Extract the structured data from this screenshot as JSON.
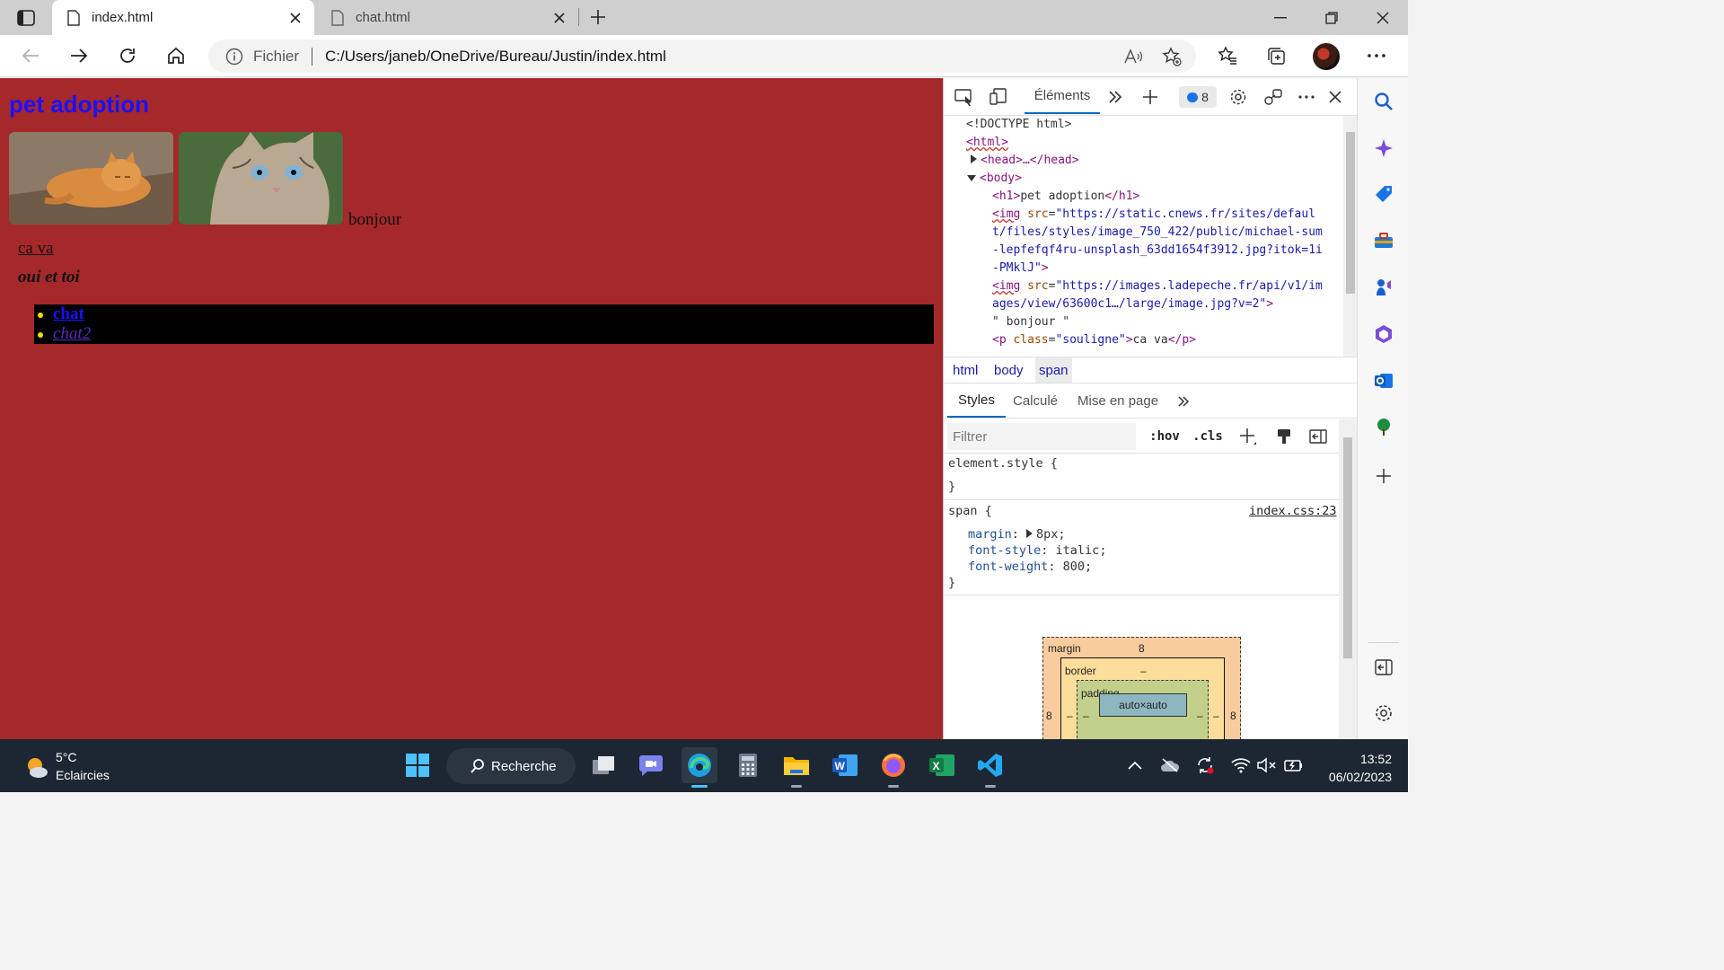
{
  "browser": {
    "tabs": [
      {
        "title": "index.html",
        "active": true
      },
      {
        "title": "chat.html",
        "active": false
      }
    ],
    "address": {
      "scheme_label": "Fichier",
      "url": "C:/Users/janeb/OneDrive/Bureau/Justin/index.html"
    }
  },
  "page": {
    "heading": "pet adoption",
    "text_bonjour": "bonjour",
    "text_cava": "ca va",
    "text_ouietoi": "oui et toi",
    "links": [
      "chat",
      "chat2"
    ],
    "background_color": "#a5282a"
  },
  "devtools": {
    "active_tab": "Éléments",
    "issues_count": "8",
    "dom": {
      "doctype": "<!DOCTYPE html>",
      "html_open": "<html>",
      "head_collapsed": "<head>…</head>",
      "body_open": "<body>",
      "h1_line": "pet adoption",
      "img1_src_1": "\"https://static.cnews.fr/sites/defaul",
      "img1_src_2": "t/files/styles/image_750_422/public/michael-sum",
      "img1_src_3": "-lepfefqf4ru-unsplash_63dd1654f3912.jpg?itok=1i",
      "img1_src_4": "-PMklJ\"",
      "img2_src_1": "\"https://images.ladepeche.fr/api/v1/im",
      "img2_src_2": "ages/view/63600c1…/large/image.jpg?v=2\"",
      "text_node": "\" bonjour \"",
      "p_class": "\"souligne\"",
      "p_text": "ca va"
    },
    "breadcrumbs": [
      "html",
      "body",
      "span"
    ],
    "style_tabs": [
      "Styles",
      "Calculé",
      "Mise en page"
    ],
    "filter_placeholder": "Filtrer",
    "tools": {
      "hov": ":hov",
      "cls": ".cls"
    },
    "rules": {
      "element_style": "element.style {",
      "close": "}",
      "span_selector": "span {",
      "source": "index.css:23",
      "margin_prop": "margin",
      "margin_val": "8px;",
      "font_style_prop": "font-style",
      "font_style_val": "italic;",
      "font_weight_prop": "font-weight",
      "font_weight_val": "800;"
    },
    "box_model": {
      "margin_label": "margin",
      "margin_top": "8",
      "margin_left": "8",
      "margin_right": "8",
      "border_label": "border",
      "border_top": "–",
      "border_left": "–",
      "border_right": "–",
      "padding_label": "padding",
      "padding_top": "–",
      "padding_left": "–",
      "padding_right": "–",
      "content": "auto×auto"
    }
  },
  "taskbar": {
    "weather_temp": "5°C",
    "weather_desc": "Eclaircies",
    "search_label": "Recherche",
    "time": "13:52",
    "date": "06/02/2023"
  }
}
